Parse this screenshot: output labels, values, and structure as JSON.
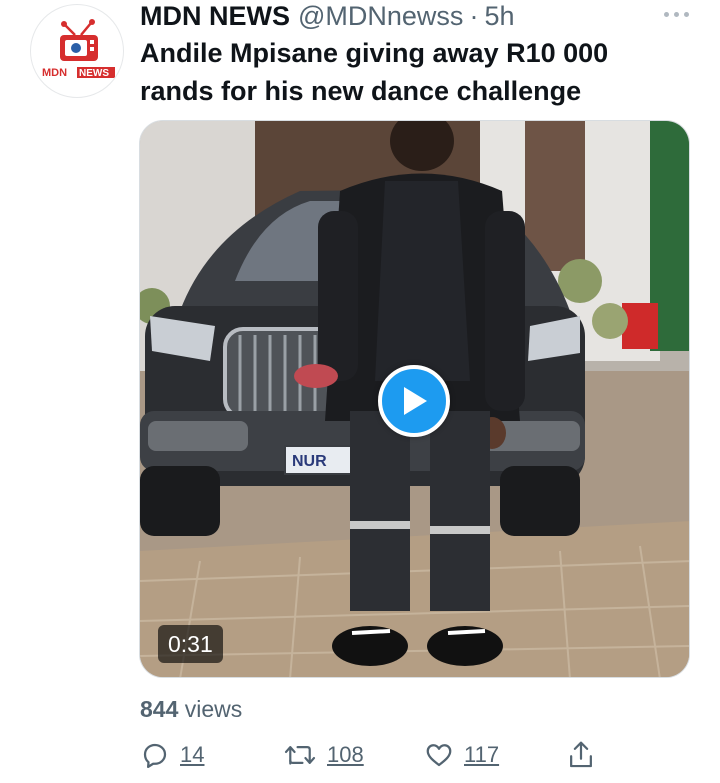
{
  "author": {
    "name": "MDN NEWS",
    "handle": "@MDNnewss",
    "separator": "·",
    "time": "5h",
    "avatar_logo_text": "MDN NEWS"
  },
  "tweet": {
    "text": "Andile Mpisane giving away R10 000 rands for his new dance challenge"
  },
  "media": {
    "type": "video",
    "duration": "0:31",
    "plate_text": "NUR"
  },
  "stats": {
    "views_count": "844",
    "views_label": " views"
  },
  "actions": {
    "replies": "14",
    "retweets": "108",
    "likes": "117"
  },
  "colors": {
    "accent": "#1d9bf0",
    "secondary_text": "#536471",
    "logo_red": "#d62e2e"
  }
}
